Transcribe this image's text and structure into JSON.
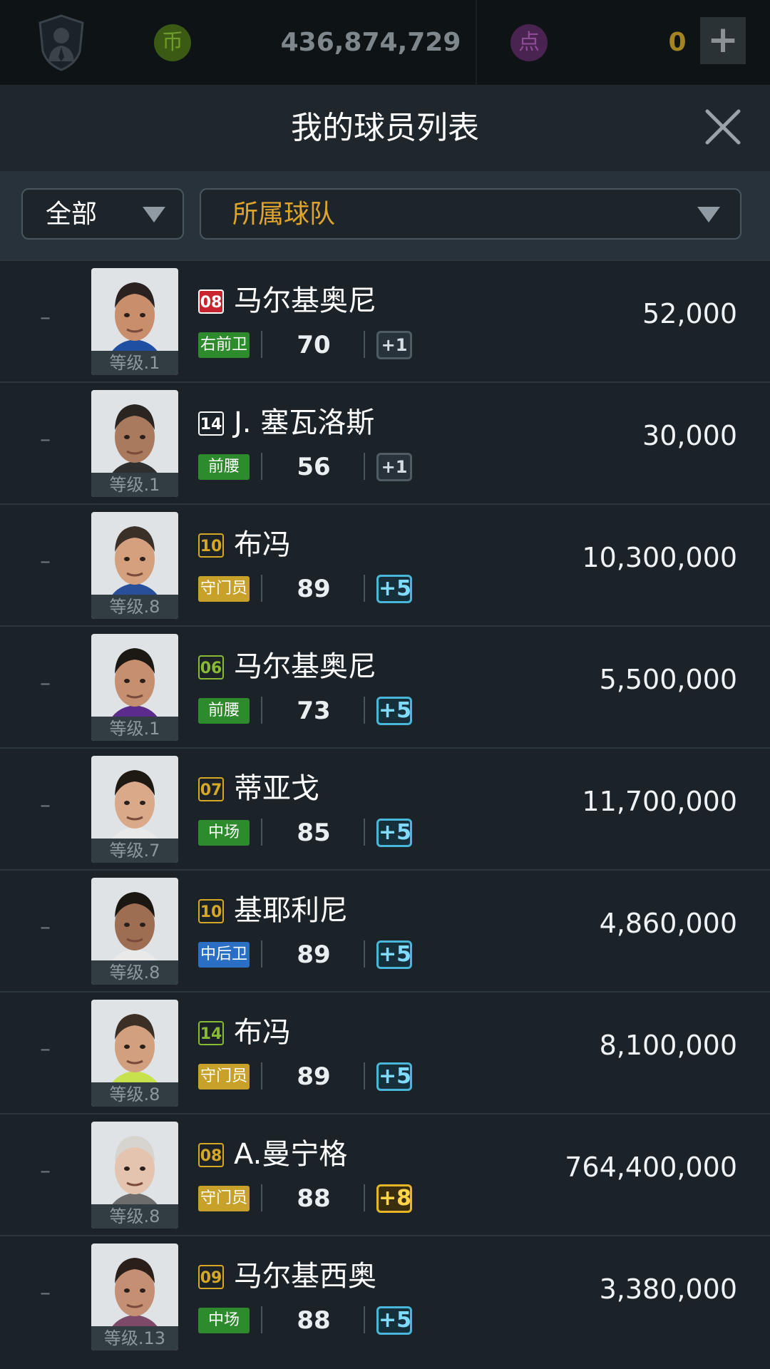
{
  "topbar": {
    "coin_label": "币",
    "coin_amount": "436,874,729",
    "point_label": "点",
    "point_amount": "0",
    "add_label": "+"
  },
  "title": "我的球员列表",
  "filters": {
    "all_label": "全部",
    "team_label": "所属球队"
  },
  "colors": {
    "pos_green": "#2d8a2d",
    "pos_gold": "#c8a12a",
    "pos_blue": "#2b6fc4",
    "num_red": "#c8242f",
    "num_white": "#ffffff",
    "num_gold": "#d6a825",
    "num_green": "#8ab934"
  },
  "players": [
    {
      "dash": "–",
      "level": "等级.1",
      "number": "08",
      "number_style": "red",
      "name": "马尔基奥尼",
      "position": "右前卫",
      "position_color": "green",
      "rating": "70",
      "upgrade": "+1",
      "upgrade_style": "up1",
      "value": "52,000"
    },
    {
      "dash": "–",
      "level": "等级.1",
      "number": "14",
      "number_style": "white",
      "name": "J. 塞瓦洛斯",
      "position": "前腰",
      "position_color": "green",
      "rating": "56",
      "upgrade": "+1",
      "upgrade_style": "up1",
      "value": "30,000"
    },
    {
      "dash": "–",
      "level": "等级.8",
      "number": "10",
      "number_style": "gold",
      "name": "布冯",
      "position": "守门员",
      "position_color": "gold",
      "rating": "89",
      "upgrade": "+5",
      "upgrade_style": "up5",
      "value": "10,300,000"
    },
    {
      "dash": "–",
      "level": "等级.1",
      "number": "06",
      "number_style": "green",
      "name": "马尔基奥尼",
      "position": "前腰",
      "position_color": "green",
      "rating": "73",
      "upgrade": "+5",
      "upgrade_style": "up5",
      "value": "5,500,000"
    },
    {
      "dash": "–",
      "level": "等级.7",
      "number": "07",
      "number_style": "gold",
      "name": "蒂亚戈",
      "position": "中场",
      "position_color": "green",
      "rating": "85",
      "upgrade": "+5",
      "upgrade_style": "up5",
      "value": "11,700,000"
    },
    {
      "dash": "–",
      "level": "等级.8",
      "number": "10",
      "number_style": "gold",
      "name": "基耶利尼",
      "position": "中后卫",
      "position_color": "blue",
      "rating": "89",
      "upgrade": "+5",
      "upgrade_style": "up5",
      "value": "4,860,000"
    },
    {
      "dash": "–",
      "level": "等级.8",
      "number": "14",
      "number_style": "green",
      "name": "布冯",
      "position": "守门员",
      "position_color": "gold",
      "rating": "89",
      "upgrade": "+5",
      "upgrade_style": "up5",
      "value": "8,100,000"
    },
    {
      "dash": "–",
      "level": "等级.8",
      "number": "08",
      "number_style": "gold",
      "name": "A.曼宁格",
      "position": "守门员",
      "position_color": "gold",
      "rating": "88",
      "upgrade": "+8",
      "upgrade_style": "up8",
      "value": "764,400,000"
    },
    {
      "dash": "–",
      "level": "等级.13",
      "number": "09",
      "number_style": "gold",
      "name": "马尔基西奥",
      "position": "中场",
      "position_color": "green",
      "rating": "88",
      "upgrade": "+5",
      "upgrade_style": "up5",
      "value": "3,380,000"
    }
  ]
}
